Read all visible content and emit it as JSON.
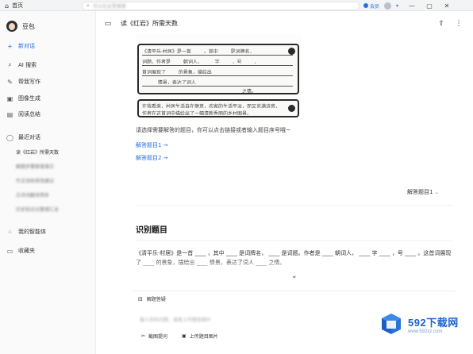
{
  "titlebar": {
    "tab_label": "首页",
    "search_placeholder": "可以在这里搜索",
    "pill_label": "会员",
    "win_minimize": "—",
    "win_maximize": "▢",
    "win_close": "✕"
  },
  "sidebar": {
    "user_name": "豆包",
    "new_chat": "新对话",
    "items": [
      {
        "label": "AI 搜索",
        "icon": "search-icon"
      },
      {
        "label": "帮我写作",
        "icon": "pen-icon"
      },
      {
        "label": "图像生成",
        "icon": "image-icon"
      },
      {
        "label": "阅读总结",
        "icon": "book-icon"
      }
    ],
    "recent_label": "最近对话",
    "recent": [
      {
        "label": "读《红岩》所需天数",
        "blurred": false
      },
      {
        "label": "解题步骤推理演示",
        "blurred": true
      },
      {
        "label": "作文润色修改建议",
        "blurred": true
      },
      {
        "label": "古诗词翻译赏析",
        "blurred": true
      },
      {
        "label": "历史知识点整理汇总",
        "blurred": true
      }
    ],
    "agents_label": "我的智能体",
    "favorites_label": "收藏夹"
  },
  "header": {
    "title": "读《红岩》所需天数"
  },
  "doc_image": {
    "box1_lines": [
      "《清平乐·村居》是一首 ____ 。其中 ____ 是词牌名，",
      "词题。作者是 ____ 朝词人， ____ 字 ____ ，号 ____ ，",
      "首词展现了 ____ 的景象，描绘出",
      "______ 情景，表达了词人"
    ],
    "box1_tail": "之情。",
    "box2_lines": [
      "在我看来，村居生活自在惬意，农家的生活平淡，而又充满诗意，",
      "作者在这首词中描绘出了一幅清新秀丽的乡村图景。"
    ]
  },
  "main": {
    "prompt": "请选择需要解答的题目，你可以点击链接或者输入题目序号哦~",
    "links": [
      "解答题目1 →",
      "解答题目2 →"
    ],
    "answer_button": "解答题目1",
    "section_title": "识别题目",
    "paragraph": "《清平乐·村居》是一首 ____ ，其中 ____ 是词牌名， ____ 是词题。作者是 ____ 朝词人， ____ 字 ____ ，号 ____ 。这首词展现了 ____ 的景象，描绘出 ____ 情景，表达了词人 ____ 之情。",
    "input_header": "解题答疑",
    "input_placeholder": "输入你的问题，或者上传题目图片",
    "tools": [
      {
        "label": "截图提问",
        "icon": "scissors-icon"
      },
      {
        "label": "上传题目图片",
        "icon": "image-upload-icon"
      }
    ]
  },
  "watermark": {
    "main": "592下载网",
    "sub": "www.592xz.com"
  }
}
